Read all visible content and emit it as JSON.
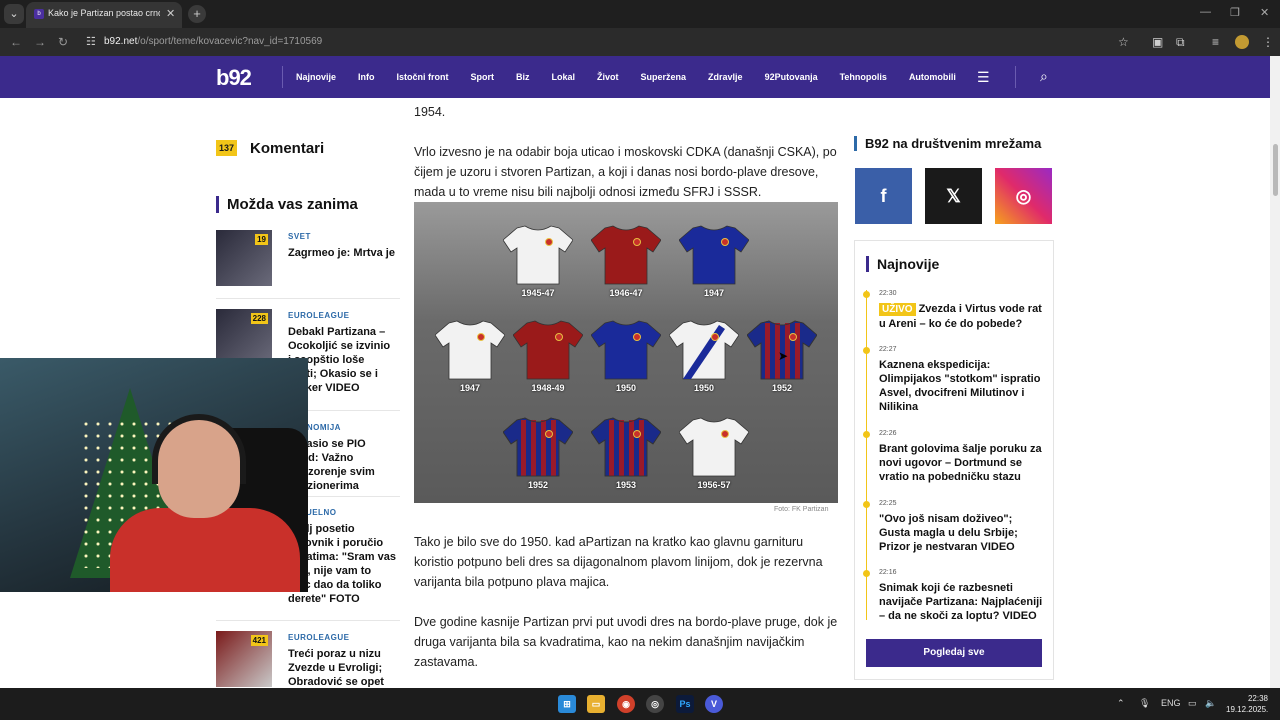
{
  "browser": {
    "tab_title": "Kako je Partizan postao crno-beli",
    "url_domain": "b92.net",
    "url_path": "/o/sport/teme/kovacevic?nav_id=1710569"
  },
  "site": {
    "logo": "b92",
    "nav": [
      "Najnovije",
      "Info",
      "Istočni front",
      "Sport",
      "Biz",
      "Lokal",
      "Život",
      "Superžena",
      "Zdravlje",
      "92Putovanja",
      "Tehnopolis",
      "Automobili"
    ]
  },
  "left": {
    "comments_count": "137",
    "comments_label": "Komentari",
    "related_heading": "Možda vas zanima",
    "related": [
      {
        "category": "SVET",
        "title": "Zagrmeo je: Mrtva je",
        "count": "19"
      },
      {
        "category": "EUROLEAGUE",
        "title": "Debakl Partizana – Ocokoljić se izvinio i saopštio loše vesti; Okasio se i Parker VIDEO",
        "count": "228"
      },
      {
        "category": "EKONOMIJA",
        "title": "Oglasio se PIO Fond: Važno upozorenje svim penzionerima",
        "count": ""
      },
      {
        "category": "AKTUELNO",
        "title": "Kralj posetio Vidovnik i poručio Hrvatima: \"Sram vas bilo, nije vam to otac dao da toliko derete\" FOTO",
        "count": ""
      },
      {
        "category": "EUROLEAGUE",
        "title": "Treći poraz u nizu Zvezde u Evroligi; Obradović se opet",
        "count": "421"
      }
    ]
  },
  "article": {
    "p0": "1954.",
    "p1": "Vrlo izvesno je na odabir boja uticao i moskovski CDKA (današnji CSKA), po čijem je uzoru i stvoren Partizan, a koji i danas nosi bordo-plave dresove, mada u to vreme nisu bili najbolji odnosi između SFRJ i SSSR.",
    "photo_credit": "Foto: FK Partizan",
    "jersey_years": [
      "1945-47",
      "1946-47",
      "1947",
      "1947",
      "1948-49",
      "1950",
      "1950",
      "1952",
      "1952",
      "1953",
      "1956-57"
    ],
    "p2": "Tako je bilo sve do 1950. kad aPartizan na kratko kao glavnu garnituru koristio potpuno beli dres sa dijagonalnom plavom linijom, dok je rezervna varijanta bila potpuno plava majica.",
    "p3": "Dve godine kasnije Partizan prvi put uvodi dres na bordo-plave pruge, dok je druga varijanta bila sa kvadratima, kao na nekim današnjim navijačkim zastavama."
  },
  "right": {
    "social_heading": "B92 na društvenim mrežama",
    "latest_heading": "Najnovije",
    "live_label": "UŽIVO",
    "news": [
      {
        "time": "22:30",
        "title": "Zvezda i Virtus vode rat u Areni – ko će do pobede?",
        "live": true
      },
      {
        "time": "22:27",
        "title": "Kaznena ekspedicija: Olimpijakos \"stotkom\" ispratio Asvel, dvocifreni Milutinov i Nilikina",
        "live": false
      },
      {
        "time": "22:26",
        "title": "Brant golovima šalje poruku za novi ugovor – Dortmund se vratio na pobedničku stazu",
        "live": false
      },
      {
        "time": "22:25",
        "title": "\"Ovo još nisam doživeo\"; Gusta magla u delu Srbije; Prizor je nestvaran VIDEO",
        "live": false
      },
      {
        "time": "22:16",
        "title": "Snimak koji će razbesneti navijače Partizana: Najplaćeniji – da ne skoči za loptu? VIDEO",
        "live": false
      }
    ],
    "more_button": "Pogledaj sve"
  },
  "taskbar": {
    "lang": "ENG",
    "time": "22:38",
    "date": "19.12.2025."
  }
}
